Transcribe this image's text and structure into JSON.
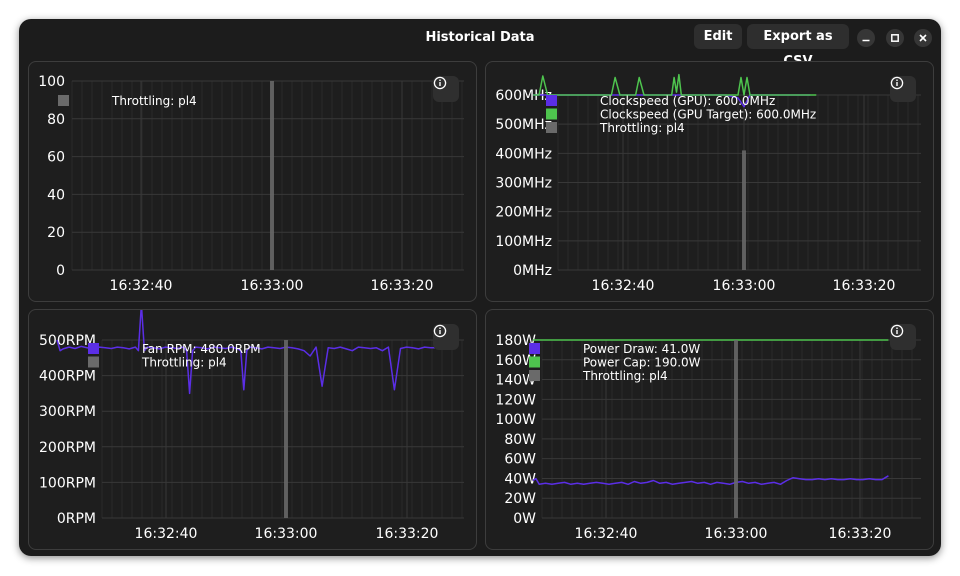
{
  "window": {
    "title": "Historical Data",
    "edit_label": "Edit",
    "export_label": "Export as CSV",
    "minimize_icon": "minimize-icon",
    "maximize_icon": "maximize-icon",
    "close_icon": "close-icon"
  },
  "colors": {
    "background": "#1e1e1e",
    "grid": "#383838",
    "text": "#ffffff",
    "purple": "#5b2ee6",
    "green": "#4ec44e",
    "throttle": "#6a6a6a"
  },
  "chart_data": [
    {
      "id": "throttle",
      "type": "line",
      "y_labels": [
        "100",
        "80",
        "60",
        "40",
        "20",
        "0"
      ],
      "x_labels": [
        "16:32:40",
        "16:33:00",
        "16:33:20"
      ],
      "ylim": [
        0,
        100
      ],
      "series": [
        {
          "name": "Throttling: pl4",
          "color": "#6a6a6a",
          "kind": "spike",
          "time": "16:33:00",
          "value": 100
        }
      ],
      "legend": [
        "Throttling: pl4"
      ]
    },
    {
      "id": "clock",
      "type": "line",
      "y_labels": [
        "600MHz",
        "500MHz",
        "400MHz",
        "300MHz",
        "200MHz",
        "100MHz",
        "0MHz"
      ],
      "x_labels": [
        "16:32:40",
        "16:33:00",
        "16:33:20"
      ],
      "ylim": [
        0,
        600
      ],
      "series": [
        {
          "name": "Clockspeed (GPU): 600.0MHz",
          "color": "#5b2ee6",
          "kind": "line",
          "t": [
            -35,
            -33,
            -31,
            -29,
            -27,
            -25,
            -23,
            -21,
            -19,
            -17,
            -15,
            -13,
            -11,
            -9,
            -7,
            -5,
            -3,
            -1,
            0,
            1,
            3,
            5,
            7,
            9,
            11
          ],
          "values": [
            600,
            600,
            600,
            600,
            600,
            600,
            600,
            600,
            600,
            600,
            600,
            600,
            600,
            600,
            600,
            600,
            600,
            590,
            560,
            600,
            600,
            600,
            600,
            600,
            600
          ]
        },
        {
          "name": "Clockspeed (GPU Target): 600.0MHz",
          "color": "#4ec44e",
          "kind": "line",
          "t": [
            -35,
            -34,
            -33.4,
            -32.6,
            -32,
            -30,
            -22,
            -21.4,
            -20.6,
            -20,
            -18,
            -17.4,
            -16.6,
            -16,
            -12,
            -11.6,
            -11.2,
            -10.8,
            -10.4,
            -10,
            -6,
            -5,
            -4,
            -3,
            -2,
            -1,
            -0.5,
            0,
            0.5,
            1,
            1.5,
            2,
            3,
            4,
            5,
            6,
            7,
            8,
            10,
            12
          ],
          "values": [
            600,
            600,
            665,
            600,
            600,
            600,
            600,
            660,
            600,
            600,
            600,
            660,
            600,
            600,
            600,
            660,
            610,
            670,
            600,
            600,
            600,
            600,
            600,
            600,
            600,
            600,
            660,
            600,
            660,
            600,
            600,
            600,
            600,
            600,
            600,
            600,
            600,
            600,
            600,
            600
          ]
        },
        {
          "name": "Throttling: pl4",
          "color": "#6a6a6a",
          "kind": "spike",
          "time": "16:33:00",
          "value": 410
        }
      ],
      "legend": [
        "Clockspeed (GPU): 600.0MHz",
        "Clockspeed (GPU Target): 600.0MHz",
        "Throttling: pl4"
      ]
    },
    {
      "id": "fan",
      "type": "line",
      "y_labels": [
        "500RPM",
        "400RPM",
        "300RPM",
        "200RPM",
        "100RPM",
        "0RPM"
      ],
      "x_labels": [
        "16:32:40",
        "16:33:00",
        "16:33:20"
      ],
      "ylim": [
        0,
        500
      ],
      "series": [
        {
          "name": "Fan RPM: 480.0RPM",
          "color": "#5b2ee6",
          "kind": "line",
          "t": [
            -38,
            -37.5,
            -37,
            -36,
            -35,
            -34,
            -33,
            -32,
            -31,
            -30,
            -29,
            -28,
            -27,
            -26,
            -25,
            -24.5,
            -24,
            -23.5,
            -23,
            -22,
            -21,
            -20,
            -19,
            -18,
            -17,
            -16.5,
            -16,
            -15.5,
            -15,
            -14,
            -13,
            -12,
            -11,
            -10,
            -9,
            -8,
            -7.5,
            -7,
            -6.5,
            -6,
            -5,
            -4,
            -3,
            -2,
            -1,
            0,
            1,
            2,
            3,
            4,
            5,
            6,
            7,
            8,
            9,
            10,
            11,
            12,
            13,
            14,
            15,
            16,
            17,
            18,
            19,
            20,
            21,
            22,
            23,
            24,
            25
          ],
          "values": [
            500,
            470,
            475,
            480,
            476,
            482,
            478,
            475,
            480,
            478,
            476,
            480,
            478,
            475,
            480,
            470,
            600,
            470,
            480,
            478,
            475,
            480,
            478,
            476,
            480,
            470,
            350,
            470,
            480,
            478,
            475,
            480,
            478,
            476,
            480,
            475,
            470,
            360,
            470,
            480,
            478,
            475,
            480,
            478,
            476,
            480,
            478,
            475,
            470,
            455,
            480,
            370,
            478,
            476,
            480,
            475,
            470,
            480,
            478,
            476,
            478,
            470,
            480,
            360,
            476,
            480,
            478,
            475,
            480,
            478,
            478
          ]
        },
        {
          "name": "Throttling: pl4",
          "color": "#6a6a6a",
          "kind": "spike",
          "time": "16:33:00",
          "value": 500
        }
      ],
      "legend": [
        "Fan RPM: 480.0RPM",
        "Throttling: pl4"
      ]
    },
    {
      "id": "power",
      "type": "line",
      "y_labels": [
        "180W",
        "160W",
        "140W",
        "120W",
        "100W",
        "80W",
        "60W",
        "40W",
        "20W",
        "0W"
      ],
      "x_labels": [
        "16:32:40",
        "16:33:00",
        "16:33:20"
      ],
      "ylim": [
        0,
        190
      ],
      "series": [
        {
          "name": "Power Draw: 41.0W",
          "color": "#5b2ee6",
          "kind": "line",
          "t": [
            -32,
            -31.5,
            -31,
            -30,
            -29,
            -28,
            -27,
            -26,
            -25,
            -24,
            -23,
            -22,
            -21,
            -20,
            -19,
            -18,
            -17,
            -16,
            -15,
            -14,
            -13,
            -12,
            -11,
            -10,
            -9,
            -8,
            -7,
            -6,
            -5,
            -4,
            -3,
            -2,
            -1,
            0,
            1,
            2,
            3,
            4,
            5,
            6,
            7,
            8,
            9,
            10,
            11,
            12,
            13,
            14,
            15,
            16,
            17,
            18,
            19,
            20,
            21,
            22,
            23,
            23.5,
            24
          ],
          "values": [
            40,
            42,
            36,
            37,
            36,
            37,
            38,
            36,
            37,
            36,
            37,
            38,
            37,
            36,
            37,
            38,
            36,
            39,
            37,
            38,
            40,
            37,
            38,
            36,
            37,
            38,
            39,
            37,
            38,
            36,
            38,
            37,
            36,
            38,
            39,
            37,
            38,
            36,
            37,
            38,
            36,
            40,
            43,
            42,
            41,
            41,
            42,
            41,
            42,
            41,
            41,
            42,
            41,
            41,
            42,
            41,
            41,
            43,
            45
          ]
        },
        {
          "name": "Power Cap: 190.0W",
          "color": "#4ec44e",
          "kind": "line",
          "t": [
            -32,
            24
          ],
          "values": [
            190,
            190
          ]
        },
        {
          "name": "Throttling: pl4",
          "color": "#6a6a6a",
          "kind": "spike",
          "time": "16:33:00",
          "value": 190
        }
      ],
      "legend": [
        "Power Draw: 41.0W",
        "Power Cap: 190.0W",
        "Throttling: pl4"
      ]
    }
  ]
}
